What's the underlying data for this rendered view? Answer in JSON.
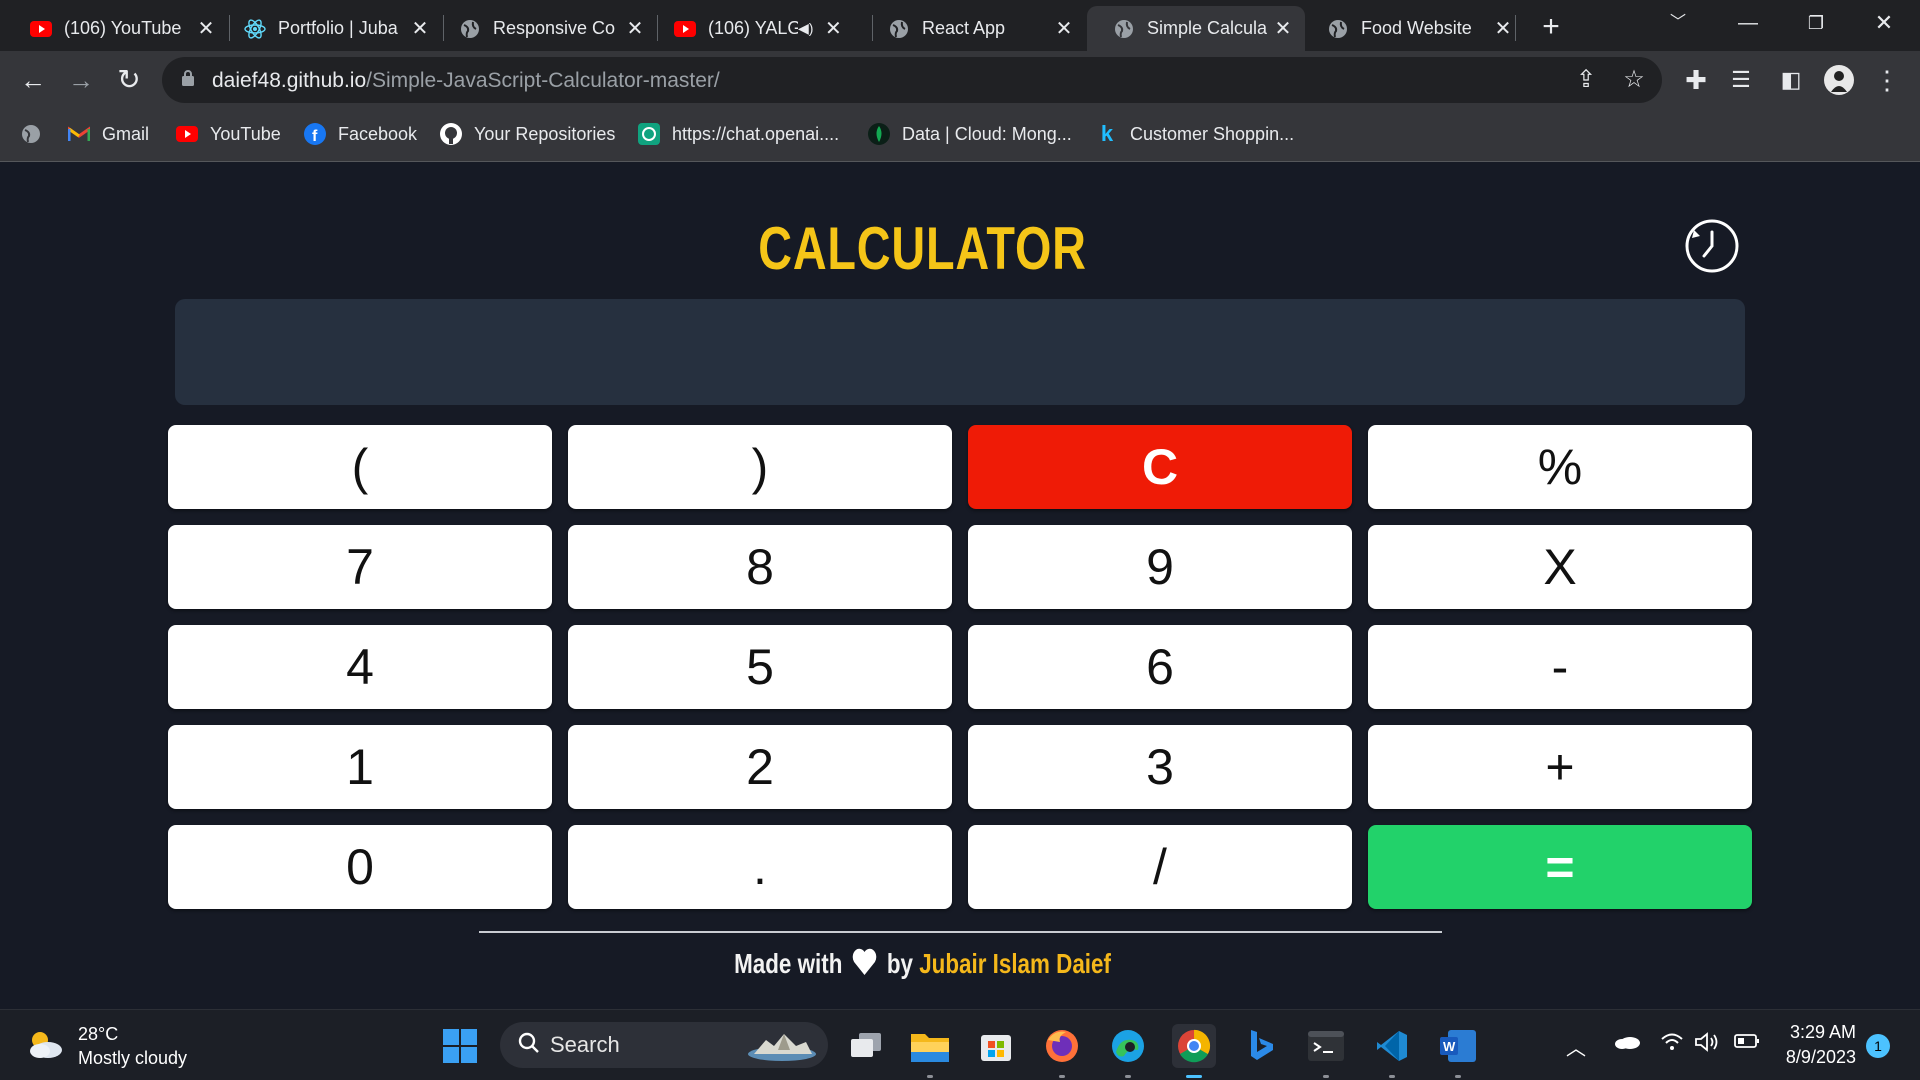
{
  "browser": {
    "tabs": [
      {
        "title": "(106) YouTube",
        "icon": "youtube-icon"
      },
      {
        "title": "Portfolio | Juba",
        "icon": "react-icon"
      },
      {
        "title": "Responsive Co",
        "icon": "globe-icon"
      },
      {
        "title": "(106) YALG",
        "icon": "youtube-icon",
        "muted_icon": "speaker-icon"
      },
      {
        "title": "React App",
        "icon": "globe-icon"
      },
      {
        "title": "Simple Calcula",
        "icon": "globe-icon",
        "active": true
      },
      {
        "title": "Food Website",
        "icon": "globe-icon"
      }
    ],
    "new_tab_label": "+",
    "url_host": "daief48.github.io",
    "url_path": "/Simple-JavaScript-Calculator-master/",
    "bookmarks": [
      {
        "label": "Gmail",
        "icon": "gmail-icon"
      },
      {
        "label": "YouTube",
        "icon": "youtube-icon"
      },
      {
        "label": "Facebook",
        "icon": "facebook-icon"
      },
      {
        "label": "Your Repositories",
        "icon": "github-icon"
      },
      {
        "label": "https://chat.openai....",
        "icon": "openai-icon"
      },
      {
        "label": "Data | Cloud: Mong...",
        "icon": "mongodb-icon"
      },
      {
        "label": "Customer Shoppin...",
        "icon": "kaggle-icon"
      }
    ]
  },
  "calculator": {
    "title": "CALCULATOR",
    "display_value": "",
    "keys": [
      {
        "label": "(",
        "type": "normal"
      },
      {
        "label": ")",
        "type": "normal"
      },
      {
        "label": "C",
        "type": "clear"
      },
      {
        "label": "%",
        "type": "normal"
      },
      {
        "label": "7",
        "type": "normal"
      },
      {
        "label": "8",
        "type": "normal"
      },
      {
        "label": "9",
        "type": "normal"
      },
      {
        "label": "X",
        "type": "normal"
      },
      {
        "label": "4",
        "type": "normal"
      },
      {
        "label": "5",
        "type": "normal"
      },
      {
        "label": "6",
        "type": "normal"
      },
      {
        "label": "-",
        "type": "normal"
      },
      {
        "label": "1",
        "type": "normal"
      },
      {
        "label": "2",
        "type": "normal"
      },
      {
        "label": "3",
        "type": "normal"
      },
      {
        "label": "+",
        "type": "normal"
      },
      {
        "label": "0",
        "type": "normal"
      },
      {
        "label": ".",
        "type": "normal"
      },
      {
        "label": "/",
        "type": "normal"
      },
      {
        "label": "=",
        "type": "equal"
      }
    ],
    "footer_prefix": "Made with",
    "footer_by": "by",
    "footer_author": "Jubair Islam Daief"
  },
  "colors": {
    "accent_yellow": "#f5c518",
    "clear_red": "#ef1b06",
    "equal_green": "#22d26a",
    "display_bg": "#26303f",
    "page_bg": "#161a25"
  },
  "taskbar": {
    "weather_temp": "28°C",
    "weather_desc": "Mostly cloudy",
    "search_placeholder": "Search",
    "time": "3:29 AM",
    "date": "8/9/2023",
    "notification_count": "1"
  }
}
